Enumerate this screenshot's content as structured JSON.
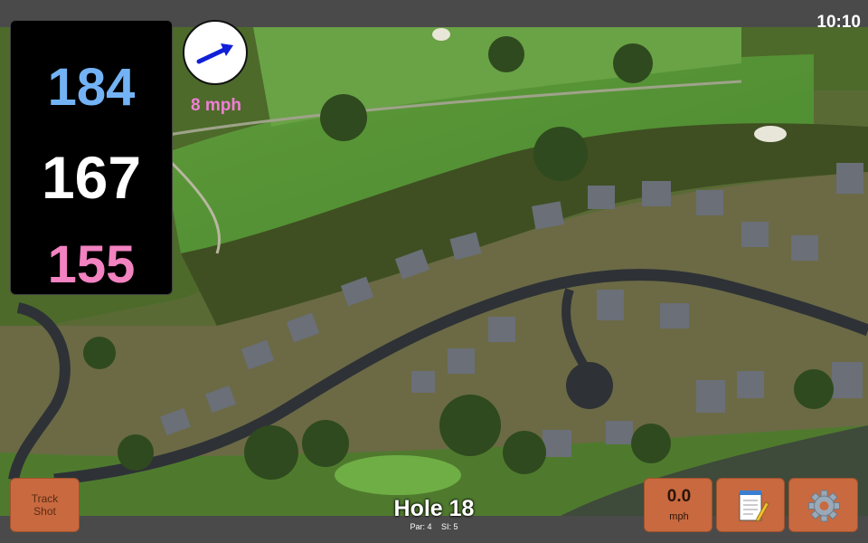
{
  "status_bar": {
    "time": "10:10"
  },
  "distances": {
    "back": "184",
    "middle": "167",
    "front": "155"
  },
  "wind": {
    "speed": "8 mph",
    "direction_icon": "arrow-icon"
  },
  "hole": {
    "title": "Hole 18",
    "par": "Par: 4",
    "stroke_index": "SI: 5"
  },
  "buttons": {
    "track_shot": {
      "line1": "Track",
      "line2": "Shot"
    },
    "shot_speed": {
      "value": "0.0",
      "unit": "mph"
    },
    "notes_icon": "notepad-icon",
    "settings_icon": "gear-icon"
  },
  "colors": {
    "back_distance": "#73b3f5",
    "middle_distance": "#ffffff",
    "front_distance": "#f282c0",
    "wind_text": "#f07ed6",
    "button": "#c8693f"
  }
}
